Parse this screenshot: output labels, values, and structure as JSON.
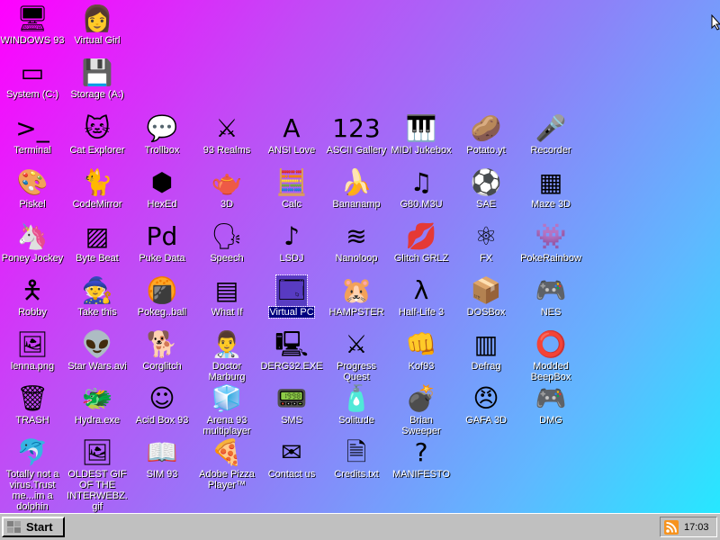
{
  "desktop": {
    "icons": [
      {
        "label": "WINDOWS 93",
        "icon": "computer-icon",
        "glyph": "🖥"
      },
      {
        "label": "Virtual Girl",
        "icon": "virtual-girl-face-icon",
        "glyph": "👩"
      },
      {
        "label": "System (C:)",
        "icon": "hard-drive-icon",
        "glyph": "▭"
      },
      {
        "label": "Storage (A:)",
        "icon": "floppy-drive-icon",
        "glyph": "💾"
      },
      {
        "label": "Terminal",
        "icon": "terminal-icon",
        "glyph": ">_"
      },
      {
        "label": "Cat Explorer",
        "icon": "cat-globe-icon",
        "glyph": "🐱"
      },
      {
        "label": "Trollbox",
        "icon": "chat-bubble-smiley-icon",
        "glyph": "💬"
      },
      {
        "label": "93 Realms",
        "icon": "red-warrior-icon",
        "glyph": "⚔"
      },
      {
        "label": "ANSI Love",
        "icon": "ansi-document-icon",
        "glyph": "A"
      },
      {
        "label": "ASCII Gallery",
        "icon": "ascii-123-icon",
        "glyph": "123"
      },
      {
        "label": "MIDI Jukebox",
        "icon": "piano-keys-icon",
        "glyph": "🎹"
      },
      {
        "label": "Potato.yt",
        "icon": "potato-icon",
        "glyph": "🥔"
      },
      {
        "label": "Recorder",
        "icon": "microphone-icon",
        "glyph": "🎤"
      },
      {
        "label": "Piskel",
        "icon": "paint-palette-icon",
        "glyph": "🎨"
      },
      {
        "label": "CodeMirror",
        "icon": "code-mirror-cat-icon",
        "glyph": "🐈"
      },
      {
        "label": "HexEd",
        "icon": "hex-cube-icon",
        "glyph": "⬢"
      },
      {
        "label": "3D",
        "icon": "teapot-icon",
        "glyph": "🫖"
      },
      {
        "label": "Calc",
        "icon": "calculator-icon",
        "glyph": "🧮"
      },
      {
        "label": "Bananamp",
        "icon": "banana-icon",
        "glyph": "🍌"
      },
      {
        "label": "G80.M3U",
        "icon": "music-document-icon",
        "glyph": "♫"
      },
      {
        "label": "SAE",
        "icon": "checkered-ball-icon",
        "glyph": "⚽"
      },
      {
        "label": "Maze 3D",
        "icon": "maze-icon",
        "glyph": "▦"
      },
      {
        "label": "Poney Jockey",
        "icon": "pony-icon",
        "glyph": "🦄"
      },
      {
        "label": "Byte Beat",
        "icon": "green-rays-icon",
        "glyph": "▨"
      },
      {
        "label": "Puke Data",
        "icon": "pd-document-icon",
        "glyph": "Pd"
      },
      {
        "label": "Speech",
        "icon": "speech-face-icon",
        "glyph": "🗣"
      },
      {
        "label": "LSDJ",
        "icon": "lsdj-icon",
        "glyph": "♪"
      },
      {
        "label": "Nanoloop",
        "icon": "nanoloop-wave-icon",
        "glyph": "≋"
      },
      {
        "label": "Glitch GRLZ",
        "icon": "red-lips-icon",
        "glyph": "💋"
      },
      {
        "label": "FX",
        "icon": "atom-icon",
        "glyph": "⚛"
      },
      {
        "label": "PokeRainbow",
        "icon": "pokemon-trainers-icon",
        "glyph": "👾"
      },
      {
        "label": "Robby",
        "icon": "stick-figure-icon",
        "glyph": "🯅"
      },
      {
        "label": "Take this",
        "icon": "pixel-man-icon",
        "glyph": "🧙"
      },
      {
        "label": "Pokeg..ball",
        "icon": "pokeball-icon",
        "glyph": "🍘"
      },
      {
        "label": "What If",
        "icon": "what-if-window-icon",
        "glyph": "▤"
      },
      {
        "label": "Virtual PC",
        "icon": "virtual-pc-window-icon",
        "glyph": "🗔"
      },
      {
        "label": "HAMPSTER",
        "icon": "hamster-icon",
        "glyph": "🐹"
      },
      {
        "label": "Half-Life 3",
        "icon": "half-life-lambda-icon",
        "glyph": "λ"
      },
      {
        "label": "DOSBox",
        "icon": "dosbox-icon",
        "glyph": "📦"
      },
      {
        "label": "NES",
        "icon": "nes-console-icon",
        "glyph": "🎮"
      },
      {
        "label": "lenna.png",
        "icon": "image-file-icon",
        "glyph": "🖼"
      },
      {
        "label": "Star Wars.avi",
        "icon": "yoda-icon",
        "glyph": "👽"
      },
      {
        "label": "Corglitch",
        "icon": "corgi-icon",
        "glyph": "🐕"
      },
      {
        "label": "Doctor Marburg",
        "icon": "doctor-face-icon",
        "glyph": "👨‍⚕"
      },
      {
        "label": "DERG32.EXE",
        "icon": "monitor-face-icon",
        "glyph": "🖳"
      },
      {
        "label": "Progress Quest",
        "icon": "crossed-swords-icon",
        "glyph": "⚔"
      },
      {
        "label": "Kof93",
        "icon": "fighter-face-icon",
        "glyph": "👊"
      },
      {
        "label": "Defrag",
        "icon": "defrag-icon",
        "glyph": "▥"
      },
      {
        "label": "Modded BeepBox",
        "icon": "green-ring-icon",
        "glyph": "⭕"
      },
      {
        "label": "TRASH",
        "icon": "recycle-bin-icon",
        "glyph": "🗑"
      },
      {
        "label": "Hydra.exe",
        "icon": "hydra-icon",
        "glyph": "🐲"
      },
      {
        "label": "Acid Box 93",
        "icon": "smiley-icon",
        "glyph": "☺"
      },
      {
        "label": "Arena 93 multiplayer",
        "icon": "arena-cube-icon",
        "glyph": "🧊"
      },
      {
        "label": "SMS",
        "icon": "sega-console-icon",
        "glyph": "📟"
      },
      {
        "label": "Solitude",
        "icon": "solitude-bottle-icon",
        "glyph": "🧴"
      },
      {
        "label": "Brian Sweeper",
        "icon": "mine-icon",
        "glyph": "💣"
      },
      {
        "label": "GAFA 3D",
        "icon": "doom-face-icon",
        "glyph": "😠"
      },
      {
        "label": "DMG",
        "icon": "gameboy-icon",
        "glyph": "🎮"
      },
      {
        "label": "Totally not a virus.Trust me...im a dolphin",
        "icon": "dolphin-icon",
        "glyph": "🐬"
      },
      {
        "label": "OLDEST GIF OF THE INTERWEBZ.gif",
        "icon": "image-file-icon",
        "glyph": "🖼"
      },
      {
        "label": "SIM 93",
        "icon": "book-icon",
        "glyph": "📖"
      },
      {
        "label": "Adobe Pizza Player™",
        "icon": "pizza-icon",
        "glyph": "🍕"
      },
      {
        "label": "Contact us",
        "icon": "contact-pen-icon",
        "glyph": "✉"
      },
      {
        "label": "Credits.txt",
        "icon": "text-file-icon",
        "glyph": "🗎"
      },
      {
        "label": "MANIFESTO",
        "icon": "question-mark-icon",
        "glyph": "?"
      }
    ]
  },
  "taskbar": {
    "start_label": "Start",
    "clock": "17:03"
  },
  "colors": {
    "accent": "#000080",
    "taskbar": "#c0c0c0",
    "gradient_start": "#ff00ff",
    "gradient_end": "#26e8ff"
  }
}
